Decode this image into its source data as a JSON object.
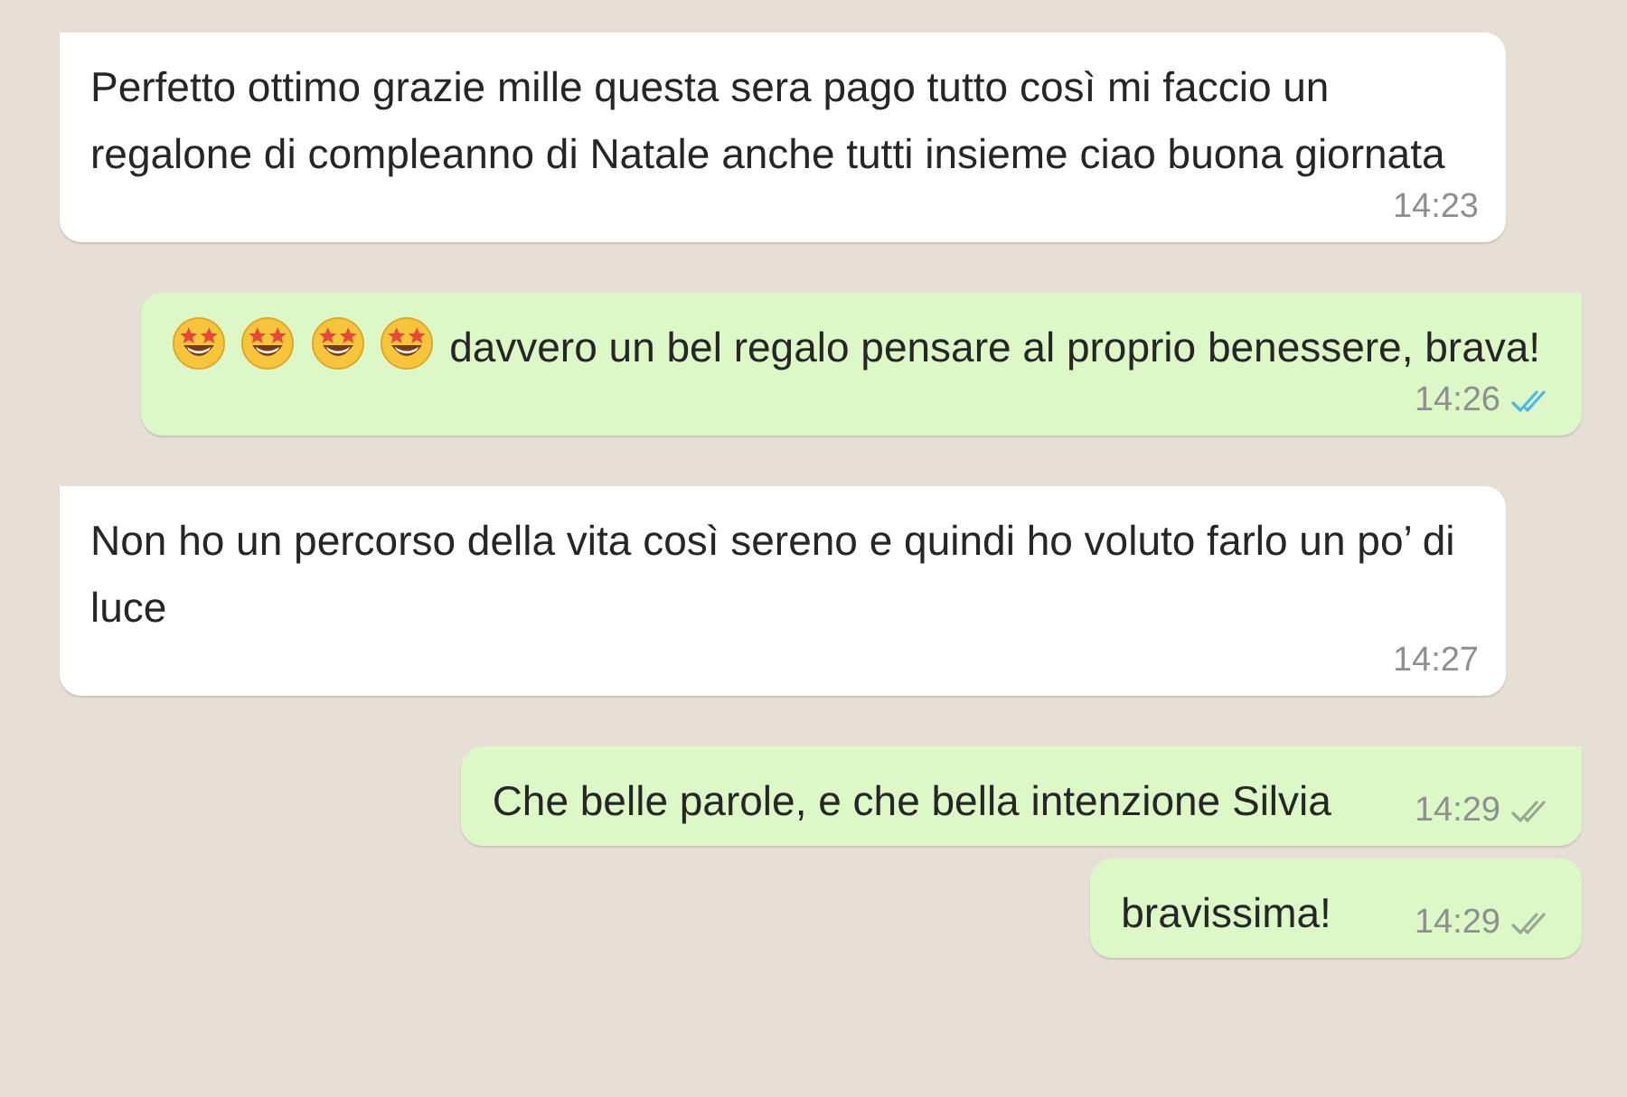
{
  "messages": [
    {
      "outgoing": false,
      "tail": true,
      "text": "Perfetto ottimo grazie mille questa sera pago tutto così mi faccio un regalone di compleanno di Natale anche tutti insieme ciao buona giornata",
      "time": "14:23"
    },
    {
      "outgoing": true,
      "tail": true,
      "emojis": [
        {
          "kind": "star-struck"
        },
        {
          "kind": "star-struck"
        },
        {
          "kind": "star-struck"
        },
        {
          "kind": "star-struck"
        }
      ],
      "text": "davvero un bel regalo pensare al proprio benessere, brava!",
      "time": "14:26",
      "read": true
    },
    {
      "outgoing": false,
      "tail": true,
      "text": "Non ho un percorso della vita così sereno e quindi ho voluto farlo un po’ di luce",
      "time": "14:27"
    },
    {
      "outgoing": true,
      "tail": true,
      "text": "Che belle parole, e che bella intenzione Silvia",
      "time": "14:29",
      "read": false
    },
    {
      "outgoing": true,
      "tail": false,
      "text": "bravissima!",
      "time": "14:29",
      "read": false
    }
  ]
}
